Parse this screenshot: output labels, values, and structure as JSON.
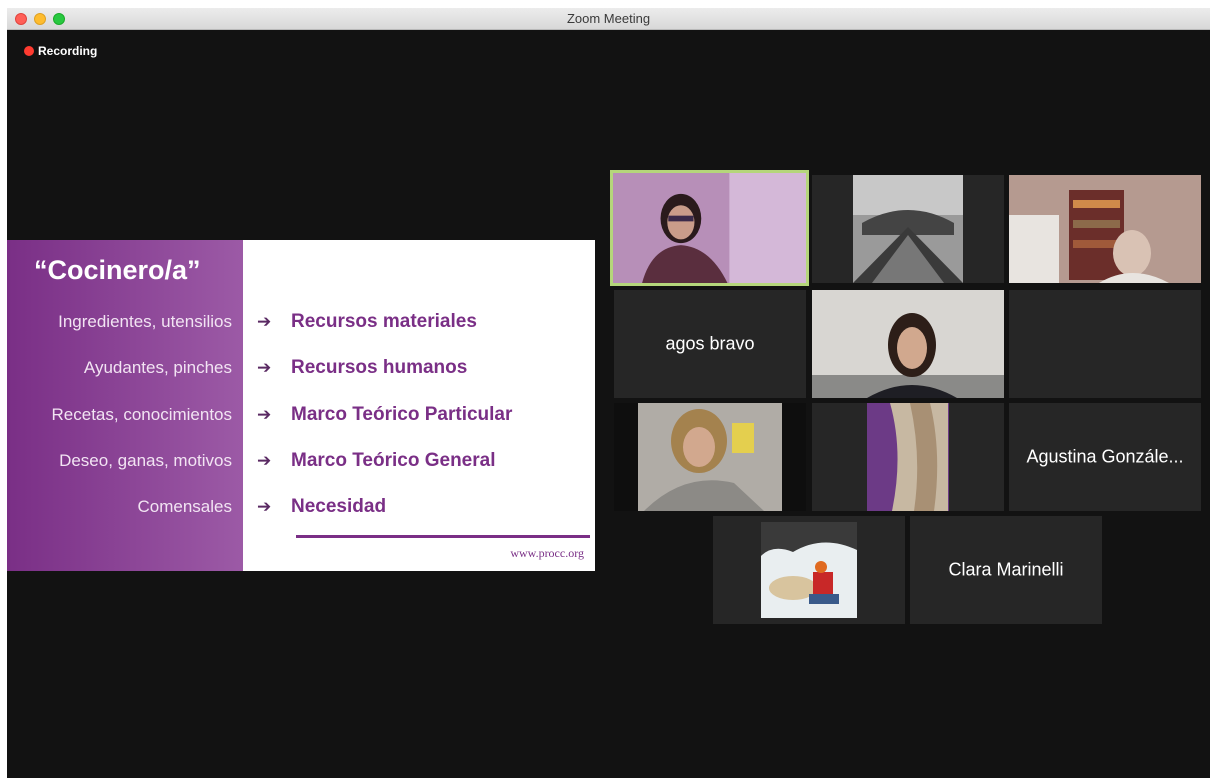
{
  "window": {
    "title": "Zoom Meeting"
  },
  "recording": {
    "label": "Recording",
    "color": "#ff3b30"
  },
  "slide": {
    "title": "“Cocinero/a”",
    "rows": [
      {
        "left": "Ingredientes, utensilios",
        "right": "Recursos materiales"
      },
      {
        "left": "Ayudantes, pinches",
        "right": "Recursos humanos"
      },
      {
        "left": "Recetas, conocimientos",
        "right": "Marco Teórico Particular"
      },
      {
        "left": "Deseo, ganas, motivos",
        "right": "Marco Teórico General"
      },
      {
        "left": "Comensales",
        "right": "Necesidad"
      }
    ],
    "arrow": "➔",
    "url": "www.procc.org",
    "accent_color": "#7a2f86"
  },
  "participants": [
    {
      "id": "p1",
      "type": "video",
      "active": true
    },
    {
      "id": "p2",
      "type": "video"
    },
    {
      "id": "p3",
      "type": "video"
    },
    {
      "id": "p4",
      "type": "name",
      "name": "agos bravo"
    },
    {
      "id": "p5",
      "type": "video"
    },
    {
      "id": "p6",
      "type": "empty"
    },
    {
      "id": "p7",
      "type": "video"
    },
    {
      "id": "p8",
      "type": "video"
    },
    {
      "id": "p9",
      "type": "name",
      "name": "Agustina Gonzále..."
    },
    {
      "id": "p10",
      "type": "video"
    },
    {
      "id": "p11",
      "type": "name",
      "name": "Clara Marinelli"
    }
  ],
  "colors": {
    "active_speaker_border": "#b5d67b",
    "tile_bg": "#262626",
    "window_bg": "#121212"
  }
}
